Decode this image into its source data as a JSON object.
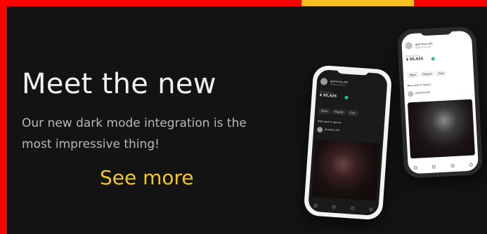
{
  "hero": {
    "headline": "Meet the new",
    "subtext": "Our new dark mode integration is the most impressive thing!",
    "cta_label": "See more"
  },
  "mockup_front": {
    "username": "gammos.eth",
    "user_sub": "@gammoscript",
    "balance_label": "Total balance",
    "balance": "$ 95,625",
    "actions": [
      "Payin",
      "Payout",
      "Cart"
    ],
    "notification": "New post in Sprout",
    "post_user": "phoenix.eth"
  },
  "mockup_back": {
    "username": "gammos.eth",
    "user_sub": "@gammoscript",
    "balance_label": "Total balance",
    "balance": "$ 95,625",
    "actions": [
      "Payin",
      "Payout",
      "Sort"
    ],
    "notification": "New post in Sprout",
    "post_user": "phoenix.eth"
  },
  "colors": {
    "frame": "#ff0000",
    "accent": "#f5c021",
    "background": "#131313",
    "cta": "#f3c623"
  }
}
